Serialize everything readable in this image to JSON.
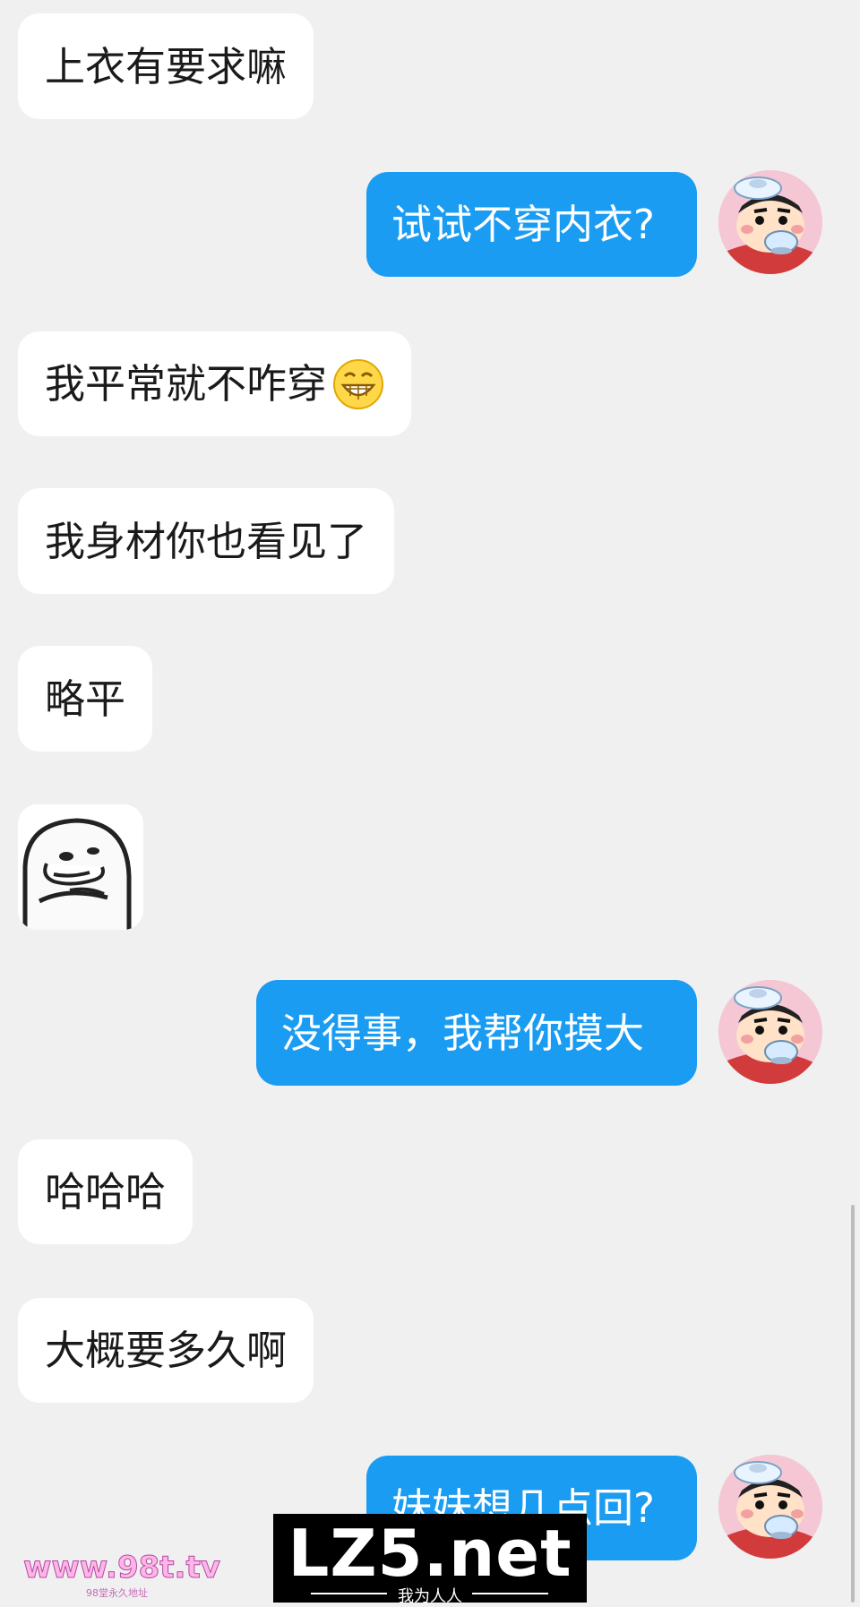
{
  "messages": [
    {
      "side": "incoming",
      "text": "上衣有要求嘛"
    },
    {
      "side": "outgoing",
      "text": "试试不穿内衣?"
    },
    {
      "side": "incoming",
      "text": "我平常就不咋穿",
      "emoji": "grinning-face-icon"
    },
    {
      "side": "incoming",
      "text": "我身材你也看见了"
    },
    {
      "side": "incoming",
      "text": "略平"
    },
    {
      "side": "incoming",
      "sticker": "smirking-face-sticker"
    },
    {
      "side": "outgoing",
      "text": "没得事，我帮你摸大"
    },
    {
      "side": "incoming",
      "text": "哈哈哈"
    },
    {
      "side": "incoming",
      "text": "大概要多久啊"
    },
    {
      "side": "outgoing",
      "text": "妹妹想几点回?"
    }
  ],
  "avatar": {
    "icon": "cartoon-boy-avatar"
  },
  "colors": {
    "background": "#f0f0f0",
    "incoming": "#ffffff",
    "outgoing": "#1a9cf2"
  },
  "watermarks": {
    "left": "www.98t.tv",
    "left_sub": "98堂永久地址",
    "right": "LZ5.net",
    "right_sub": "我为人人"
  }
}
